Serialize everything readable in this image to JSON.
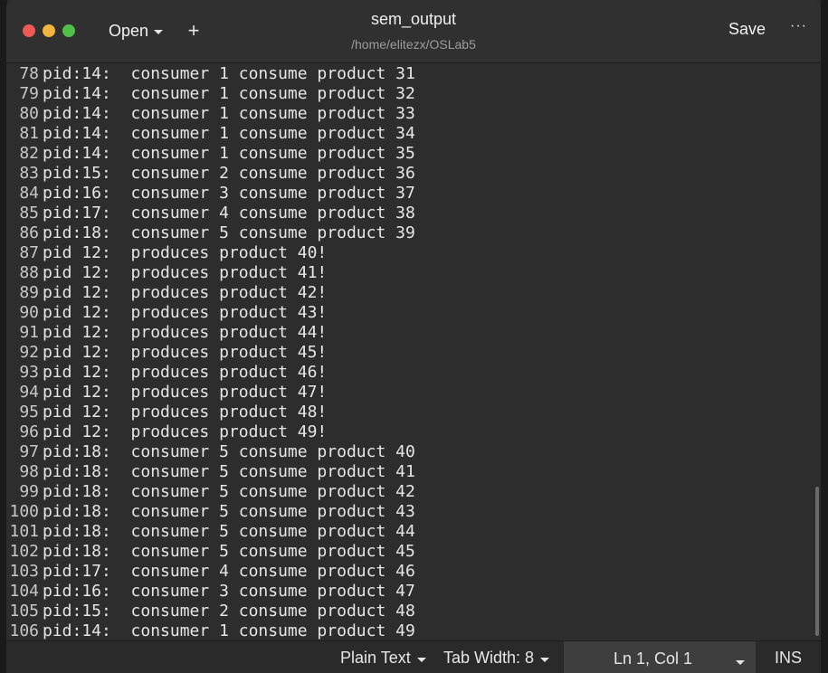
{
  "window": {
    "title": "sem_output",
    "subtitle": "/home/elitezx/OSLab5",
    "open_label": "Open",
    "new_tab_label": "+",
    "save_label": "Save",
    "menu_label": "···"
  },
  "editor": {
    "lines": [
      {
        "n": "78",
        "text": "pid:14:  consumer 1 consume product 31"
      },
      {
        "n": "79",
        "text": "pid:14:  consumer 1 consume product 32"
      },
      {
        "n": "80",
        "text": "pid:14:  consumer 1 consume product 33"
      },
      {
        "n": "81",
        "text": "pid:14:  consumer 1 consume product 34"
      },
      {
        "n": "82",
        "text": "pid:14:  consumer 1 consume product 35"
      },
      {
        "n": "83",
        "text": "pid:15:  consumer 2 consume product 36"
      },
      {
        "n": "84",
        "text": "pid:16:  consumer 3 consume product 37"
      },
      {
        "n": "85",
        "text": "pid:17:  consumer 4 consume product 38"
      },
      {
        "n": "86",
        "text": "pid:18:  consumer 5 consume product 39"
      },
      {
        "n": "87",
        "text": "pid 12:  produces product 40!"
      },
      {
        "n": "88",
        "text": "pid 12:  produces product 41!"
      },
      {
        "n": "89",
        "text": "pid 12:  produces product 42!"
      },
      {
        "n": "90",
        "text": "pid 12:  produces product 43!"
      },
      {
        "n": "91",
        "text": "pid 12:  produces product 44!"
      },
      {
        "n": "92",
        "text": "pid 12:  produces product 45!"
      },
      {
        "n": "93",
        "text": "pid 12:  produces product 46!"
      },
      {
        "n": "94",
        "text": "pid 12:  produces product 47!"
      },
      {
        "n": "95",
        "text": "pid 12:  produces product 48!"
      },
      {
        "n": "96",
        "text": "pid 12:  produces product 49!"
      },
      {
        "n": "97",
        "text": "pid:18:  consumer 5 consume product 40"
      },
      {
        "n": "98",
        "text": "pid:18:  consumer 5 consume product 41"
      },
      {
        "n": "99",
        "text": "pid:18:  consumer 5 consume product 42"
      },
      {
        "n": "100",
        "text": "pid:18:  consumer 5 consume product 43"
      },
      {
        "n": "101",
        "text": "pid:18:  consumer 5 consume product 44"
      },
      {
        "n": "102",
        "text": "pid:18:  consumer 5 consume product 45"
      },
      {
        "n": "103",
        "text": "pid:17:  consumer 4 consume product 46"
      },
      {
        "n": "104",
        "text": "pid:16:  consumer 3 consume product 47"
      },
      {
        "n": "105",
        "text": "pid:15:  consumer 2 consume product 48"
      },
      {
        "n": "106",
        "text": "pid:14:  consumer 1 consume product 49"
      }
    ]
  },
  "statusbar": {
    "language": "Plain Text",
    "tab_width": "Tab Width: 8",
    "cursor_position": "Ln 1, Col 1",
    "insert_mode": "INS"
  },
  "colors": {
    "traffic_close": "#ed5a55",
    "traffic_minimize": "#f1b43c",
    "traffic_maximize": "#4fbf48",
    "editor_background": "#2d2d2d"
  }
}
